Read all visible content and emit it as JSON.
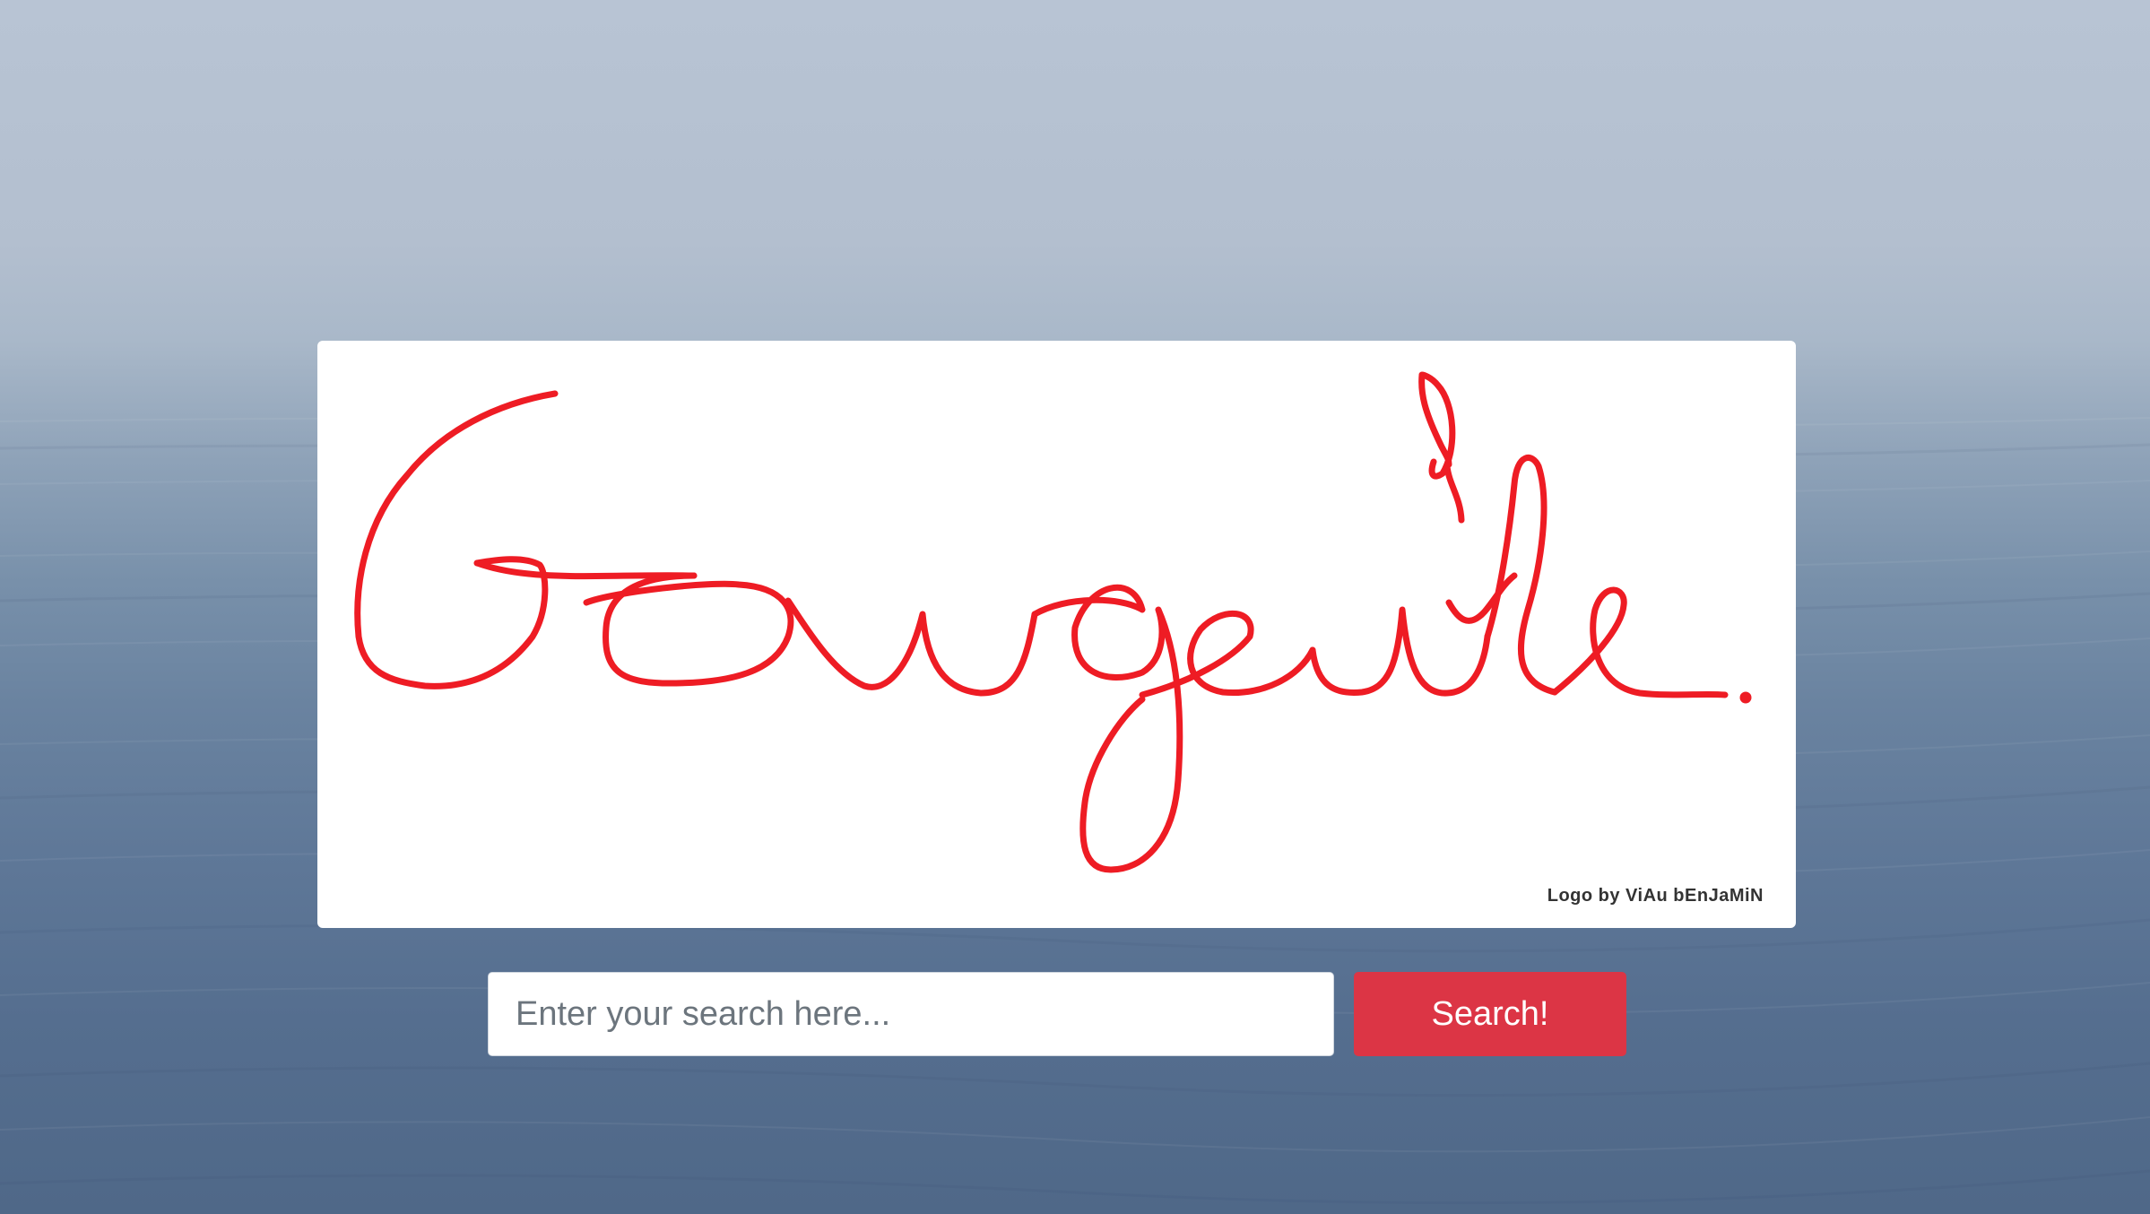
{
  "logo": {
    "wordmark": "Gougeule",
    "credit": "Logo by ViAu bEnJaMiN"
  },
  "search": {
    "placeholder": "Enter your search here...",
    "value": "",
    "button_label": "Search!"
  },
  "colors": {
    "logo_ink": "#ee1c24",
    "button": "#dc3545",
    "card": "#ffffff"
  }
}
